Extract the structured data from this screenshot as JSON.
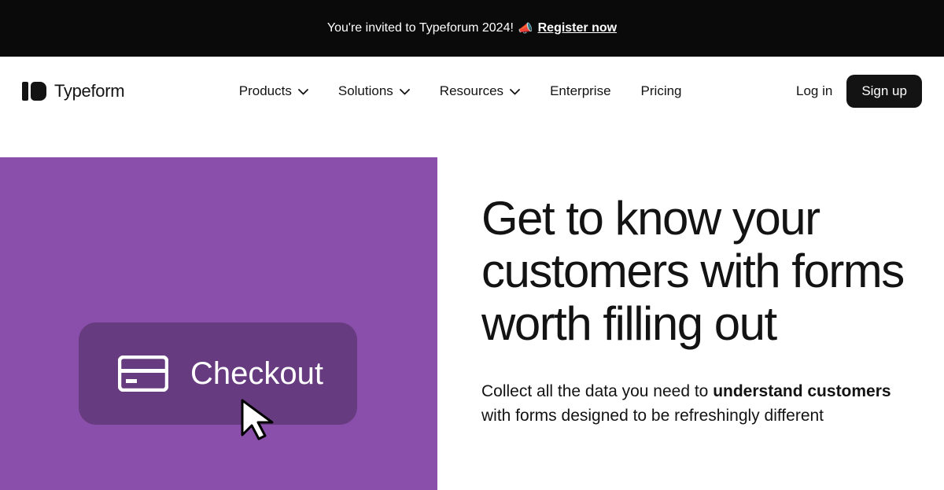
{
  "announce": {
    "text": "You're invited to Typeforum 2024!",
    "link": "Register now"
  },
  "brand": {
    "name": "Typeform"
  },
  "nav": {
    "items": [
      {
        "label": "Products",
        "dropdown": true
      },
      {
        "label": "Solutions",
        "dropdown": true
      },
      {
        "label": "Resources",
        "dropdown": true
      },
      {
        "label": "Enterprise",
        "dropdown": false
      },
      {
        "label": "Pricing",
        "dropdown": false
      }
    ],
    "login": "Log in",
    "signup": "Sign up"
  },
  "hero": {
    "checkout_label": "Checkout",
    "headline": "Get to know your customers with forms worth filling out",
    "sub_pre": "Collect all the data you need to ",
    "sub_bold": "understand customers",
    "sub_post": " with forms designed to be refreshingly different"
  },
  "colors": {
    "hero_bg": "#8a4faa",
    "ink": "#131313"
  }
}
